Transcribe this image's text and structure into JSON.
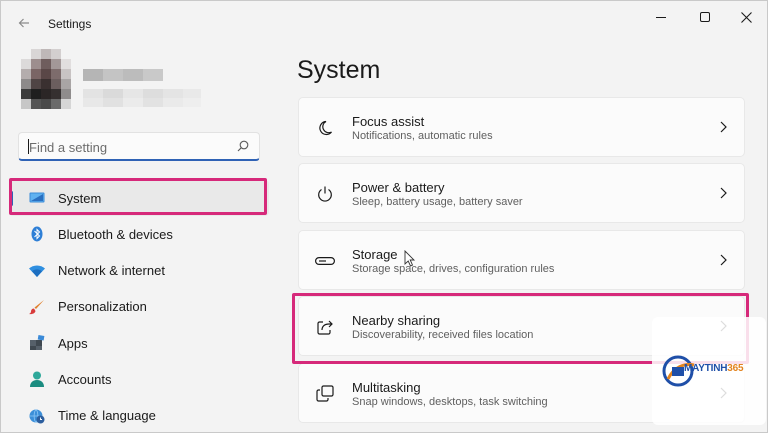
{
  "window": {
    "title": "Settings"
  },
  "search": {
    "placeholder": "Find a setting"
  },
  "sidebar": {
    "items": [
      {
        "label": "System",
        "icon": "system-icon",
        "active": true
      },
      {
        "label": "Bluetooth & devices",
        "icon": "bluetooth-icon"
      },
      {
        "label": "Network & internet",
        "icon": "wifi-icon"
      },
      {
        "label": "Personalization",
        "icon": "brush-icon"
      },
      {
        "label": "Apps",
        "icon": "apps-icon"
      },
      {
        "label": "Accounts",
        "icon": "person-icon"
      },
      {
        "label": "Time & language",
        "icon": "globe-clock-icon"
      }
    ]
  },
  "main": {
    "title": "System",
    "cards": [
      {
        "title": "Focus assist",
        "subtitle": "Notifications, automatic rules",
        "icon": "moon-icon"
      },
      {
        "title": "Power & battery",
        "subtitle": "Sleep, battery usage, battery saver",
        "icon": "power-icon"
      },
      {
        "title": "Storage",
        "subtitle": "Storage space, drives, configuration rules",
        "icon": "storage-icon"
      },
      {
        "title": "Nearby sharing",
        "subtitle": "Discoverability, received files location",
        "icon": "share-icon"
      },
      {
        "title": "Multitasking",
        "subtitle": "Snap windows, desktops, task switching",
        "icon": "multitask-icon"
      }
    ]
  },
  "watermark": {
    "brand": "MAYTINH",
    "brand_number": "365"
  },
  "colors": {
    "accent": "#2f62b5",
    "highlight": "#d6297a",
    "background": "#f3f3f3",
    "card": "#fbfbfb"
  }
}
